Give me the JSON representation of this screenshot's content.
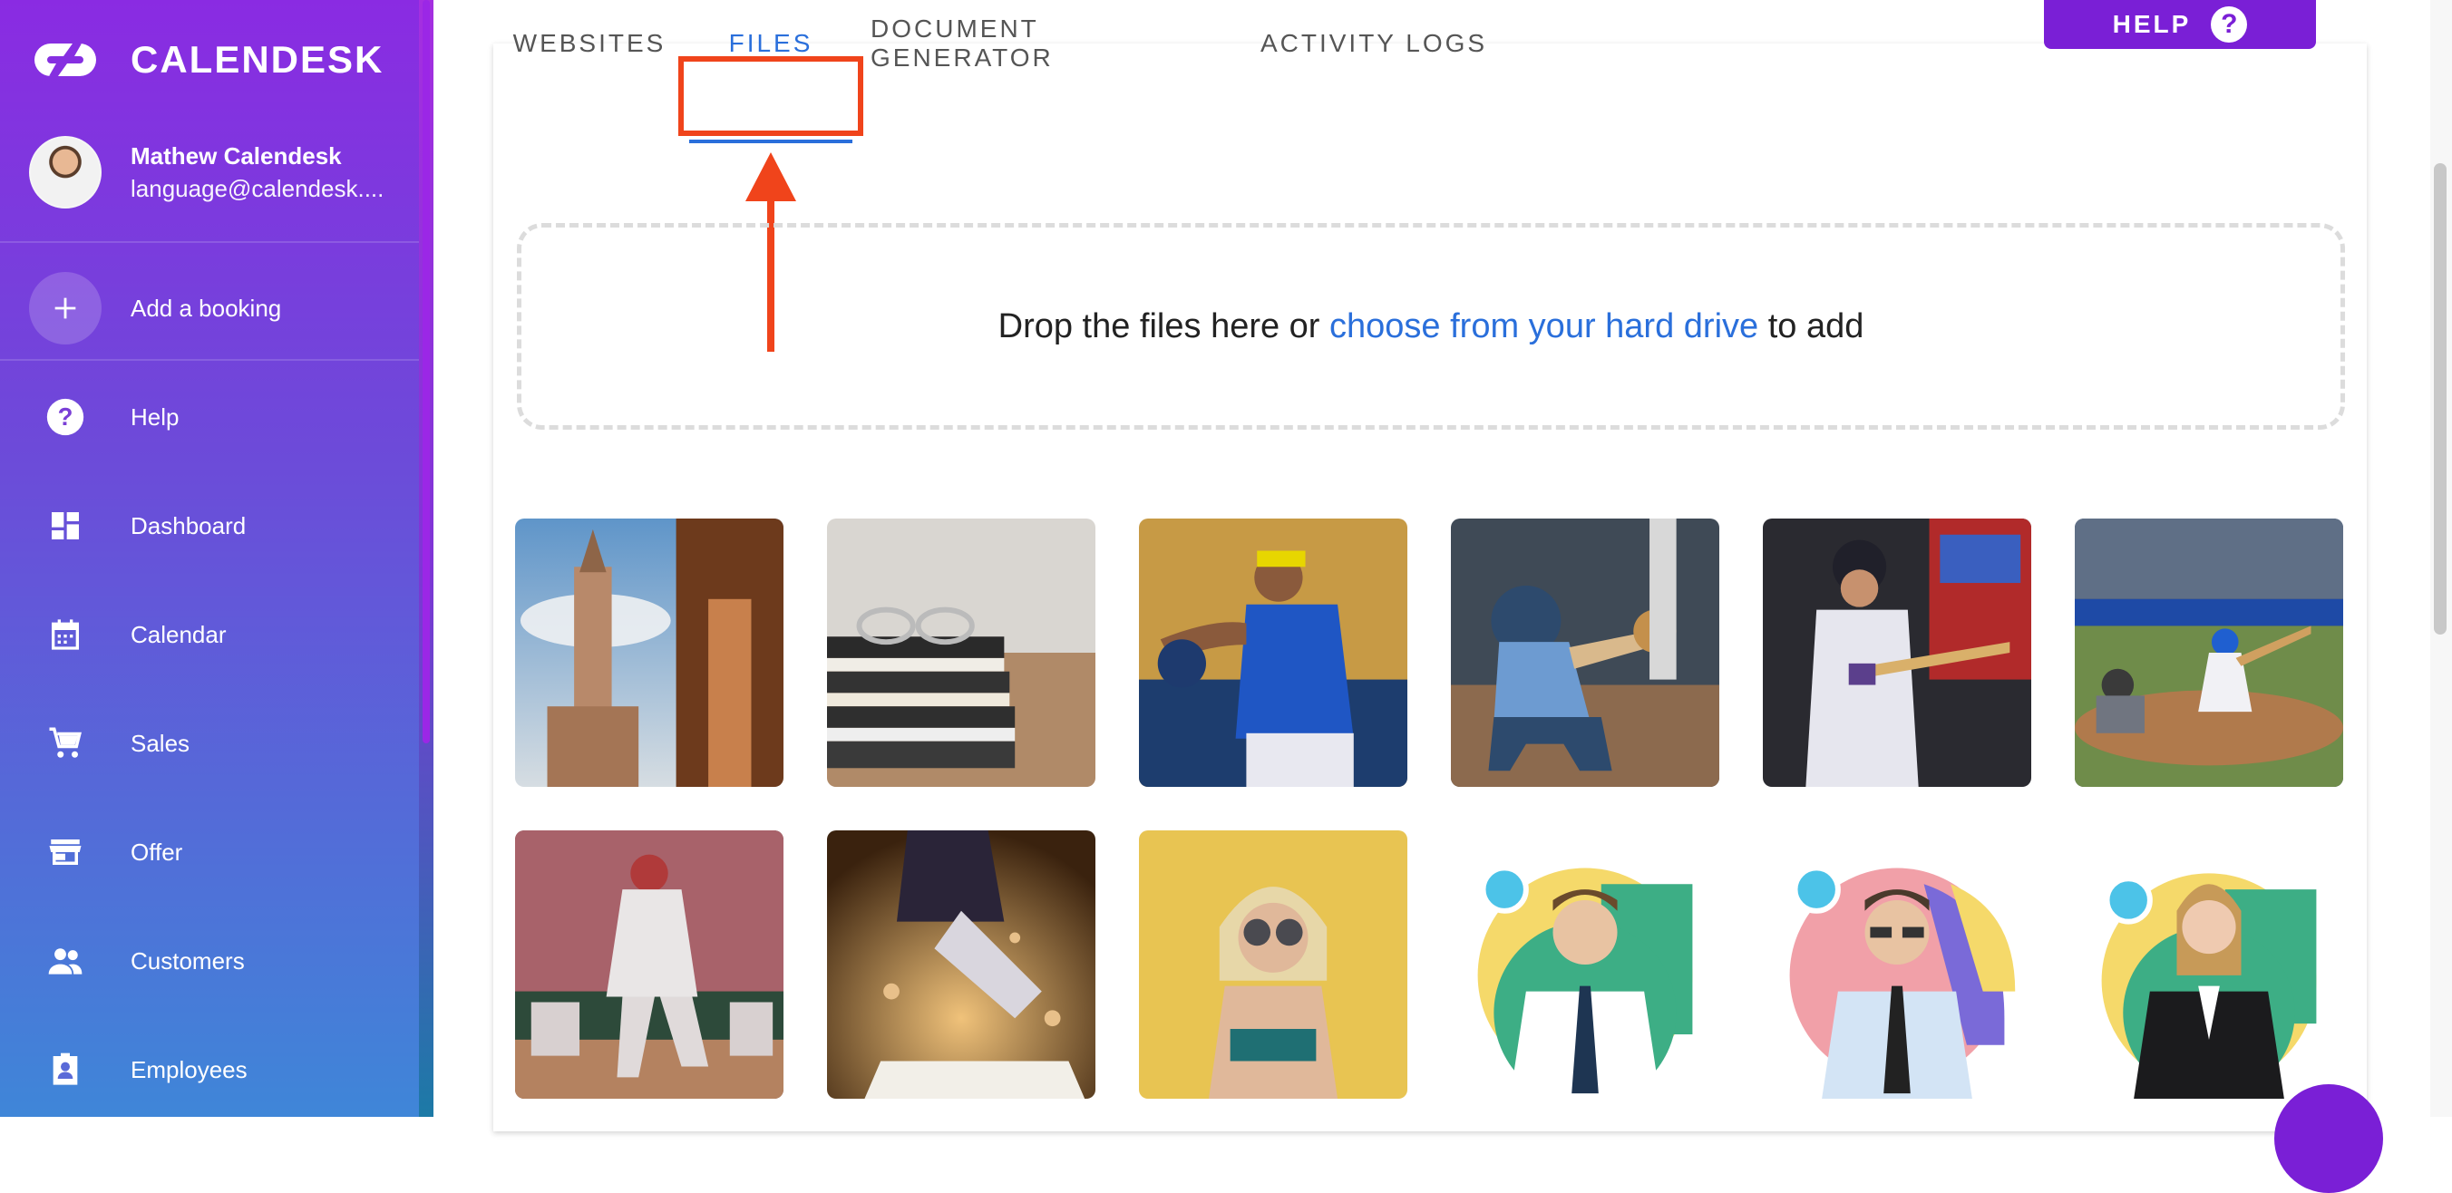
{
  "brand": {
    "name": "CALENDESK"
  },
  "profile": {
    "name": "Mathew Calendesk",
    "email": "language@calendesk...."
  },
  "sidebar": {
    "items": [
      {
        "label": "Add a booking",
        "icon": "plus-icon"
      },
      {
        "label": "Help",
        "icon": "question-circle-icon"
      },
      {
        "label": "Dashboard",
        "icon": "dashboard-icon"
      },
      {
        "label": "Calendar",
        "icon": "calendar-icon"
      },
      {
        "label": "Sales",
        "icon": "cart-icon"
      },
      {
        "label": "Offer",
        "icon": "store-icon"
      },
      {
        "label": "Customers",
        "icon": "people-icon"
      },
      {
        "label": "Employees",
        "icon": "badge-icon"
      }
    ]
  },
  "help_button": {
    "label": "HELP",
    "icon_glyph": "?"
  },
  "tabs": [
    {
      "label": "WEBSITES",
      "active": false
    },
    {
      "label": "FILES",
      "active": true
    },
    {
      "label": "DOCUMENT GENERATOR",
      "active": false
    },
    {
      "label": "ACTIVITY LOGS",
      "active": false
    }
  ],
  "dropzone": {
    "prefix": "Drop the files here or",
    "link": "choose from your hard drive",
    "suffix": "to add"
  },
  "files": [
    {
      "name": "tower-photo",
      "icon": "image-icon"
    },
    {
      "name": "books-glasses-photo",
      "icon": "image-icon"
    },
    {
      "name": "pitcher-photo",
      "icon": "image-icon"
    },
    {
      "name": "catcher-photo",
      "icon": "image-icon"
    },
    {
      "name": "batter-photo",
      "icon": "image-icon"
    },
    {
      "name": "baseball-game-photo",
      "icon": "image-icon"
    },
    {
      "name": "pitcher-stadium-photo",
      "icon": "image-icon"
    },
    {
      "name": "sliding-dust-photo",
      "icon": "image-icon"
    },
    {
      "name": "woman-yellow-photo",
      "icon": "image-icon"
    },
    {
      "name": "man-tie-avatar",
      "icon": "image-icon"
    },
    {
      "name": "man-glasses-avatar",
      "icon": "image-icon"
    },
    {
      "name": "woman-suit-avatar",
      "icon": "image-icon"
    }
  ],
  "colors": {
    "accent": "#7a1fd6",
    "link": "#2a6fdb",
    "highlight": "#f0441b"
  }
}
